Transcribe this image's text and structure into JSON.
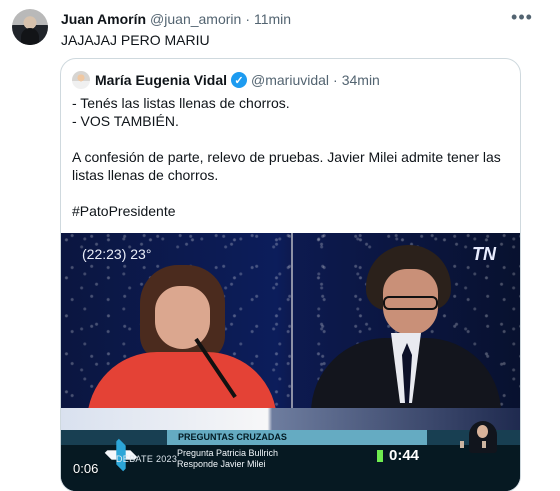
{
  "tweet": {
    "author_name": "Juan Amorín",
    "handle": "@juan_amorin",
    "dot": "·",
    "time": "11min",
    "text": "JAJAJAJ PERO MARIU",
    "more_icon": "more-icon"
  },
  "quote": {
    "author_name": "María Eugenia Vidal",
    "verified_badge": "✓",
    "handle": "@mariuvidal",
    "dot": "·",
    "time": "34min",
    "line_1": "- Tenés las listas llenas de chorros.",
    "line_2": "- VOS TAMBIÉN.",
    "line_3": "A confesión de parte, relevo de pruebas. Javier Milei admite tener las",
    "line_4": "listas llenas de chorros.",
    "hashtag": "#PatoPresidente"
  },
  "media": {
    "timestamp": "(22:23) 23°",
    "broadcaster": "TN",
    "segment": "PREGUNTAS CRUZADAS",
    "debate_label": "DEBATE 2023",
    "question_line": "Pregunta Patricia Bullrich",
    "answer_line": "Responde Javier Milei",
    "countdown": "0:44",
    "duration": "0:06"
  }
}
